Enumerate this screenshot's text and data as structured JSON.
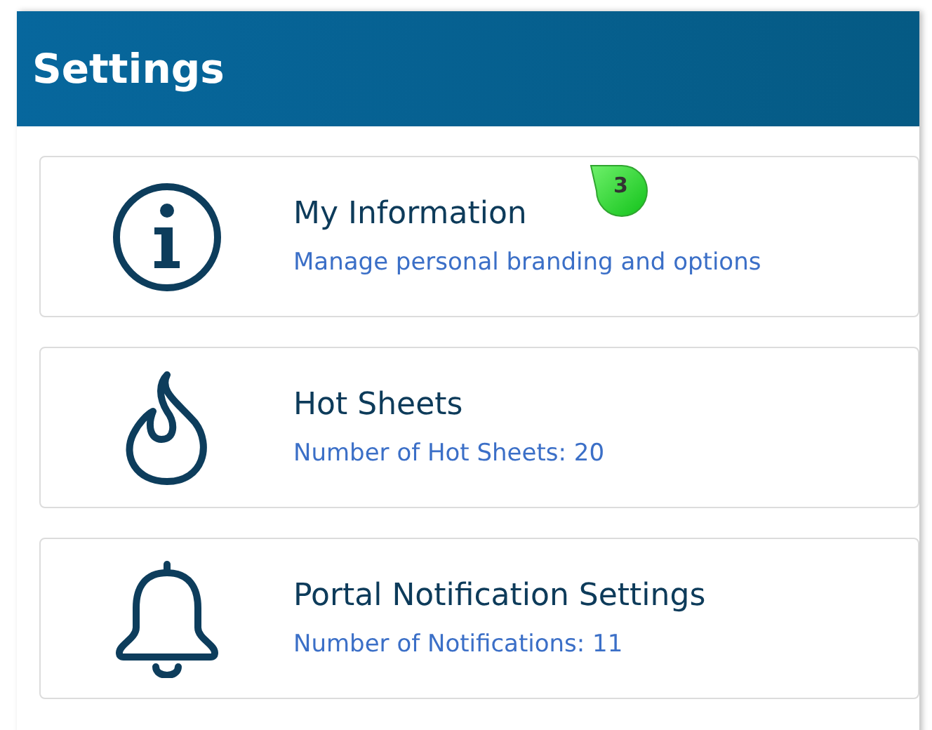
{
  "header": {
    "title": "Settings"
  },
  "items": [
    {
      "kind": "info",
      "title": "My Information",
      "subtitle": "Manage personal branding and options",
      "badge": "3"
    },
    {
      "kind": "flame",
      "title": "Hot Sheets",
      "subtitle": "Number of Hot Sheets: 20"
    },
    {
      "kind": "bell",
      "title": "Portal Notification Settings",
      "subtitle": "Number of Notifications: 11"
    }
  ]
}
